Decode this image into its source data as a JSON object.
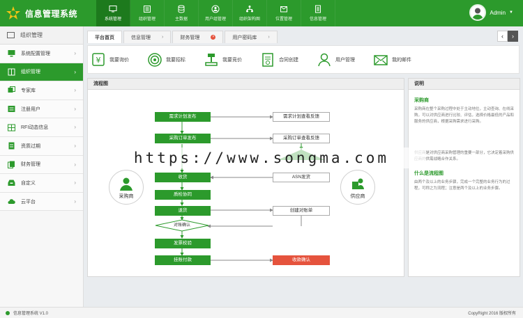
{
  "app": {
    "title": "信息管理系统",
    "user": "Admin"
  },
  "nav": [
    {
      "label": "系统管理",
      "icon": "monitor-icon"
    },
    {
      "label": "组织管理",
      "icon": "list-icon"
    },
    {
      "label": "主数据",
      "icon": "database-icon"
    },
    {
      "label": "用户组管理",
      "icon": "user-group-icon"
    },
    {
      "label": "组织架构图",
      "icon": "org-chart-icon"
    },
    {
      "label": "位置管理",
      "icon": "location-icon"
    },
    {
      "label": "信息管理",
      "icon": "document-icon"
    }
  ],
  "sidebar": {
    "header": "组织管理",
    "items": [
      {
        "label": "系统配置管理"
      },
      {
        "label": "组织管理"
      },
      {
        "label": "专家库"
      },
      {
        "label": "注册用户"
      },
      {
        "label": "RFI动态信息"
      },
      {
        "label": "资质过期"
      },
      {
        "label": "财务管理"
      },
      {
        "label": "自定义"
      },
      {
        "label": "云平台"
      }
    ]
  },
  "tabs": [
    {
      "label": "平台首页"
    },
    {
      "label": "信息管理"
    },
    {
      "label": "财务管理"
    },
    {
      "label": "用户密码库"
    }
  ],
  "quick": [
    {
      "label": "我要询价"
    },
    {
      "label": "我要招标"
    },
    {
      "label": "我要竞价"
    },
    {
      "label": "合同创建"
    },
    {
      "label": "用户管理"
    },
    {
      "label": "我的邮件"
    }
  ],
  "flow": {
    "title": "流程图",
    "buyer": "采购商",
    "supplier": "供应商",
    "steps": {
      "s1": "需求计划发布",
      "s1r": "需求计划查看反馈",
      "s2": "采购订单发布",
      "s2r": "采购订单查看反馈",
      "s3": "收货",
      "s3r": "ASN发货",
      "s4": "质检协同",
      "s5": "退货",
      "s5r": "创建对账单",
      "s6": "对账确认",
      "s7": "发票校验",
      "s8": "挂账付款",
      "s8r": "收款确认"
    }
  },
  "desc": {
    "title": "说明",
    "sec1_title": "采购商",
    "sec1_text": "采购商在整个采购过程中处于主动地位，主动查询、在线采购，可以对供应商进行比较、评估，选择价格最低的产品和服务的供应商，根据采购需求进行采购。",
    "sec2_text": "供应商是对供应商采购管理的重要一部分，它决定着采购供应商的供需战略合作关系。",
    "sec3_title": "什么是流程图",
    "sec3_text": "由两个及以上的业务步骤，完成一个完整的业务行为的过程，可称之为流程；注意是两个及以上的业务步骤。"
  },
  "footer": {
    "left": "信息管理系统 V1.0",
    "right": "CopyRight 2016 版权所有"
  },
  "watermark": "https://www.songma.com",
  "colors": {
    "primary": "#2c9a2c",
    "primary_dark": "#1d7a1d",
    "alert": "#e5533d"
  }
}
